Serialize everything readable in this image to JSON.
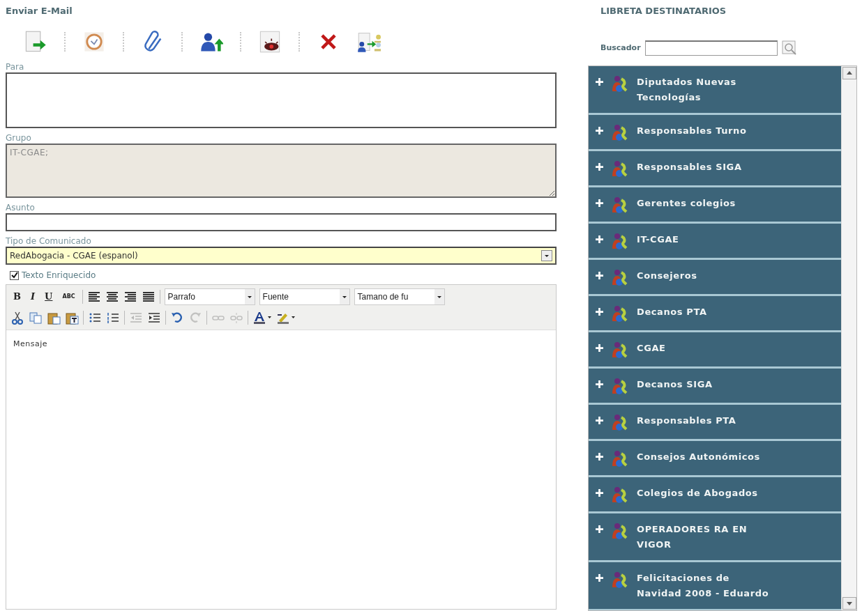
{
  "compose": {
    "title": "Enviar E-Mail",
    "toolbar": [
      {
        "kind": "send"
      },
      {
        "kind": "schedule"
      },
      {
        "kind": "attach"
      },
      {
        "kind": "add-contact"
      },
      {
        "kind": "preview"
      },
      {
        "kind": "delete"
      },
      {
        "kind": "transfer"
      }
    ],
    "to": {
      "label": "Para"
    },
    "group": {
      "label": "Grupo",
      "value": "IT-CGAE;"
    },
    "subject": {
      "label": "Asunto"
    },
    "type": {
      "label": "Tipo de Comunicado",
      "value": "RedAbogacia - CGAE (espanol)"
    },
    "rich_text": {
      "label": "Texto Enriquecido",
      "checked": true
    },
    "editor": {
      "format_buttons": [
        "B",
        "I",
        "U",
        "ABC"
      ],
      "align_tools": [
        {
          "kind": "left"
        },
        {
          "kind": "center"
        },
        {
          "kind": "right"
        },
        {
          "kind": "justify"
        }
      ],
      "dropdowns": [
        "Parrafo",
        "Fuente",
        "Tamano de fu"
      ],
      "tools": [
        {
          "kind": "cut",
          "disabled": false
        },
        {
          "kind": "copy",
          "disabled": false
        },
        {
          "kind": "paste",
          "disabled": false
        },
        {
          "kind": "paste-text",
          "disabled": false
        },
        {
          "kind": "sep"
        },
        {
          "kind": "bullets",
          "disabled": false
        },
        {
          "kind": "numbers",
          "disabled": false
        },
        {
          "kind": "sep"
        },
        {
          "kind": "outdent",
          "disabled": true
        },
        {
          "kind": "indent",
          "disabled": false
        },
        {
          "kind": "sep"
        },
        {
          "kind": "undo",
          "disabled": false
        },
        {
          "kind": "redo",
          "disabled": true
        },
        {
          "kind": "sep"
        },
        {
          "kind": "link",
          "disabled": true
        },
        {
          "kind": "unlink",
          "disabled": true
        },
        {
          "kind": "sep"
        },
        {
          "kind": "text-color",
          "disabled": false
        },
        {
          "kind": "highlight",
          "disabled": false
        }
      ],
      "content": "Mensaje"
    }
  },
  "address_book": {
    "title": "LIBRETA DESTINATARIOS",
    "search_label": "Buscador",
    "groups": [
      {
        "name": "Diputados Nuevas Tecnologías"
      },
      {
        "name": "Responsables Turno"
      },
      {
        "name": "Responsables SIGA"
      },
      {
        "name": "Gerentes colegios"
      },
      {
        "name": "IT-CGAE"
      },
      {
        "name": "Consejeros"
      },
      {
        "name": "Decanos PTA"
      },
      {
        "name": "CGAE"
      },
      {
        "name": "Decanos SIGA"
      },
      {
        "name": "Responsables PTA"
      },
      {
        "name": "Consejos Autonómicos"
      },
      {
        "name": "Colegios de Abogados"
      },
      {
        "name": "OPERADORES RA EN VIGOR"
      },
      {
        "name": "Felicitaciones de Navidad 2008 - Eduardo"
      }
    ]
  }
}
